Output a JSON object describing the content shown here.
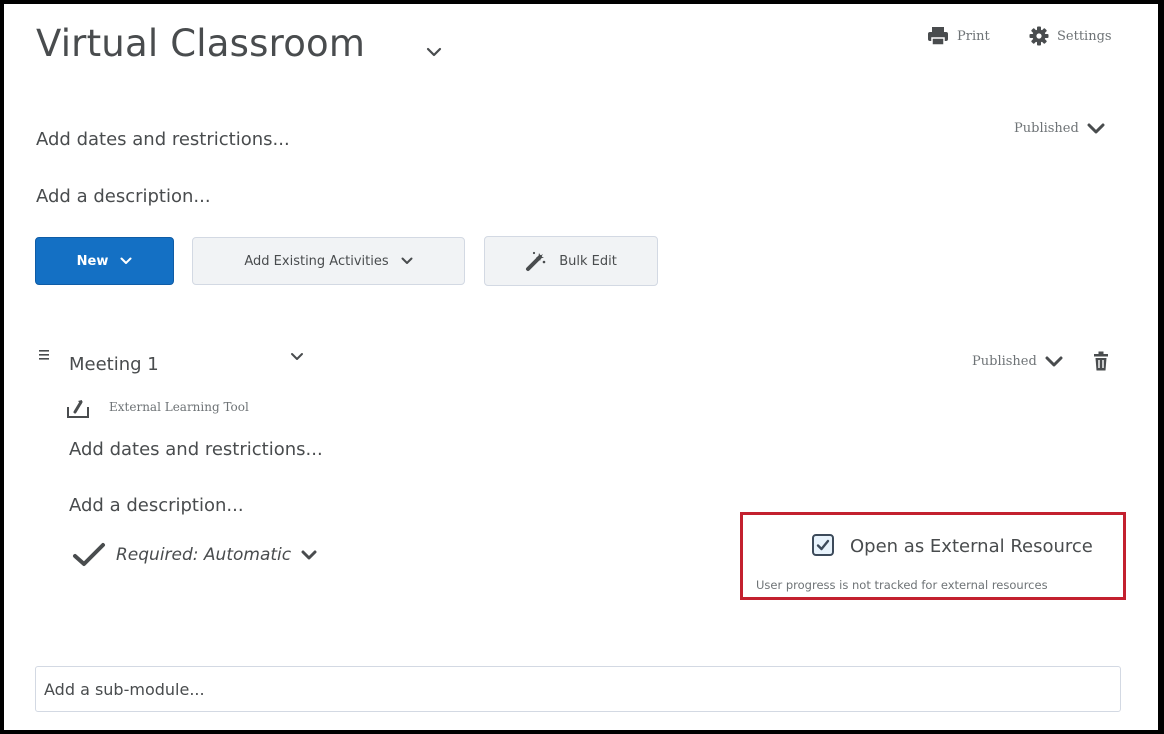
{
  "header": {
    "title": "Virtual Classroom",
    "print_label": "Print",
    "settings_label": "Settings"
  },
  "module": {
    "dates_link": "Add dates and restrictions...",
    "description_link": "Add a description...",
    "status": "Published"
  },
  "toolbar": {
    "new_label": "New",
    "add_existing_label": "Add Existing Activities",
    "bulk_edit_label": "Bulk Edit"
  },
  "topic": {
    "title": "Meeting 1",
    "status": "Published",
    "tool_type": "External Learning Tool",
    "dates_link": "Add dates and restrictions...",
    "description_link": "Add a description...",
    "completion": "Required: Automatic",
    "open_external": {
      "checked": true,
      "label": "Open as External Resource",
      "note": "User progress is not tracked for external resources"
    }
  },
  "submodule": {
    "placeholder": "Add a sub-module..."
  },
  "colors": {
    "primary": "#1470c4",
    "highlight_border": "#c3202f",
    "text": "#494c4e",
    "muted": "#6e7376"
  },
  "icons": [
    "chevron-down-icon",
    "printer-icon",
    "gear-icon",
    "magic-wand-icon",
    "drag-handle-icon",
    "trash-icon",
    "external-tool-icon",
    "checkmark-icon",
    "checkbox-checked-icon"
  ]
}
